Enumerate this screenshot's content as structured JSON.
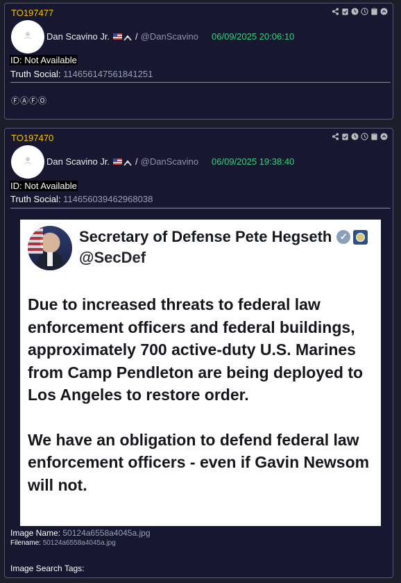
{
  "posts": [
    {
      "id": "TO197477",
      "author": "Dan Scavino Jr.",
      "separator": "/",
      "handle": "@DanScavino",
      "date": "06/09/2025 20:06:10",
      "id_label": "ID: Not Available",
      "truth_label": "Truth Social:",
      "truth_number": "114656147561841251",
      "body": "ⒻⒶⒻⓄ"
    },
    {
      "id": "TO197470",
      "author": "Dan Scavino Jr.",
      "separator": "/",
      "handle": "@DanScavino",
      "date": "06/09/2025 19:38:40",
      "id_label": "ID: Not Available",
      "truth_label": "Truth Social:",
      "truth_number": "114656039462968038",
      "image": {
        "name": "Secretary of Defense Pete Hegseth",
        "handle": "@SecDef",
        "paragraphs": [
          "Due to increased threats to federal law enforcement officers and federal buildings, approximately 700 active-duty U.S. Marines from Camp Pendleton are being deployed to Los Angeles to restore order.",
          "We have an obligation to defend federal law enforcement officers - even if Gavin Newsom will not."
        ]
      },
      "image_name_label": "Image Name:",
      "image_name": "50124a6558a4045a.jpg",
      "filename_label": "Filename:",
      "filename": "50124a6558a4045a.jpg",
      "search_tags_label": "Image Search Tags:"
    }
  ],
  "icons": [
    "share-icon",
    "clipboard-check-icon",
    "clock-filled-icon",
    "clock-outline-icon",
    "clipboard-icon",
    "chevron-up-icon"
  ],
  "colors": {
    "post_id": "#f3c300",
    "date": "#36d27c",
    "background": "#171731"
  }
}
